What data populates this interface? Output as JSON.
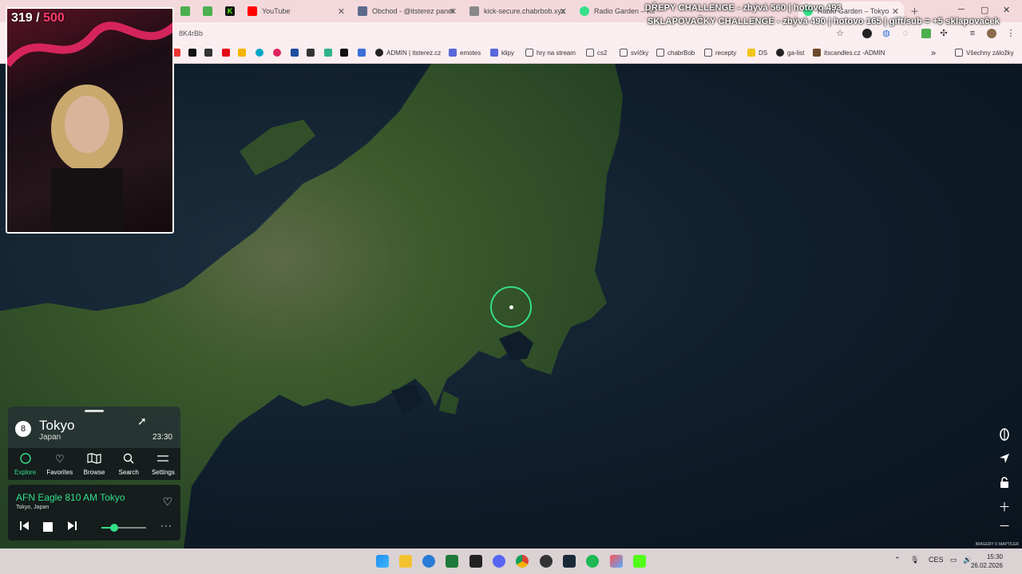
{
  "stream_overlay": {
    "counter_current": "319",
    "counter_sep": "/",
    "counter_total": "500",
    "challenge_1": "DŘEPY CHALLENGE - zbývá 560 | hotovo 493",
    "challenge_2": "SKLAPOVAČKY CHALLENGE - zbývá 490 | hotovo 165 | gift/sub = +5 sklapovaček"
  },
  "browser": {
    "tabs": [
      {
        "label": "YouTube",
        "color": "#ff0000"
      },
      {
        "label": "Obchod - @itsterez panel",
        "color": "#5b6b8c"
      },
      {
        "label": "kick-secure.chabrbob.xyz",
        "color": "#555555"
      },
      {
        "label": "Radio Garden – Kiss",
        "color": "#33e088"
      },
      {
        "label": "Radio Garden – Tokyo",
        "color": "#33e088"
      }
    ],
    "url": "8K4rBb",
    "bookmarks": [
      {
        "label": "ADMIN | itsterez.cz",
        "icon": "github-icon"
      },
      {
        "label": "emotes",
        "icon": "sl-icon"
      },
      {
        "label": "klipy",
        "icon": "sl-icon"
      },
      {
        "label": "hry na stream",
        "icon": "folder-icon"
      },
      {
        "label": "cs2",
        "icon": "folder-icon"
      },
      {
        "label": "svíčky",
        "icon": "folder-icon"
      },
      {
        "label": "chabrBob",
        "icon": "cb-icon"
      },
      {
        "label": "recepty",
        "icon": "folder-icon"
      },
      {
        "label": "DS",
        "icon": "ds-icon"
      },
      {
        "label": "ga-list",
        "icon": "github-icon"
      },
      {
        "label": "itscandles.cz -ADMIN",
        "icon": "candle-icon"
      }
    ],
    "bookmarks_more": "»",
    "all_bookmarks": "Všechny záložky"
  },
  "radio": {
    "station_count": "8",
    "city": "Tokyo",
    "country": "Japan",
    "local_time": "23:30",
    "nav": [
      {
        "label": "Explore",
        "icon": "explore-icon"
      },
      {
        "label": "Favorites",
        "icon": "heart-icon"
      },
      {
        "label": "Browse",
        "icon": "map-icon"
      },
      {
        "label": "Search",
        "icon": "search-icon"
      },
      {
        "label": "Settings",
        "icon": "menu-icon"
      }
    ],
    "station_name": "AFN Eagle 810 AM Tokyo",
    "station_location": "Tokyo, Japan",
    "volume_level": 0.28,
    "accent": "#33e088"
  },
  "map": {
    "attribution": "IMAGERY © MAPTILER"
  },
  "taskbar": {
    "tray_lang": "CES",
    "time": "15:30",
    "date": "26.02.2026"
  }
}
